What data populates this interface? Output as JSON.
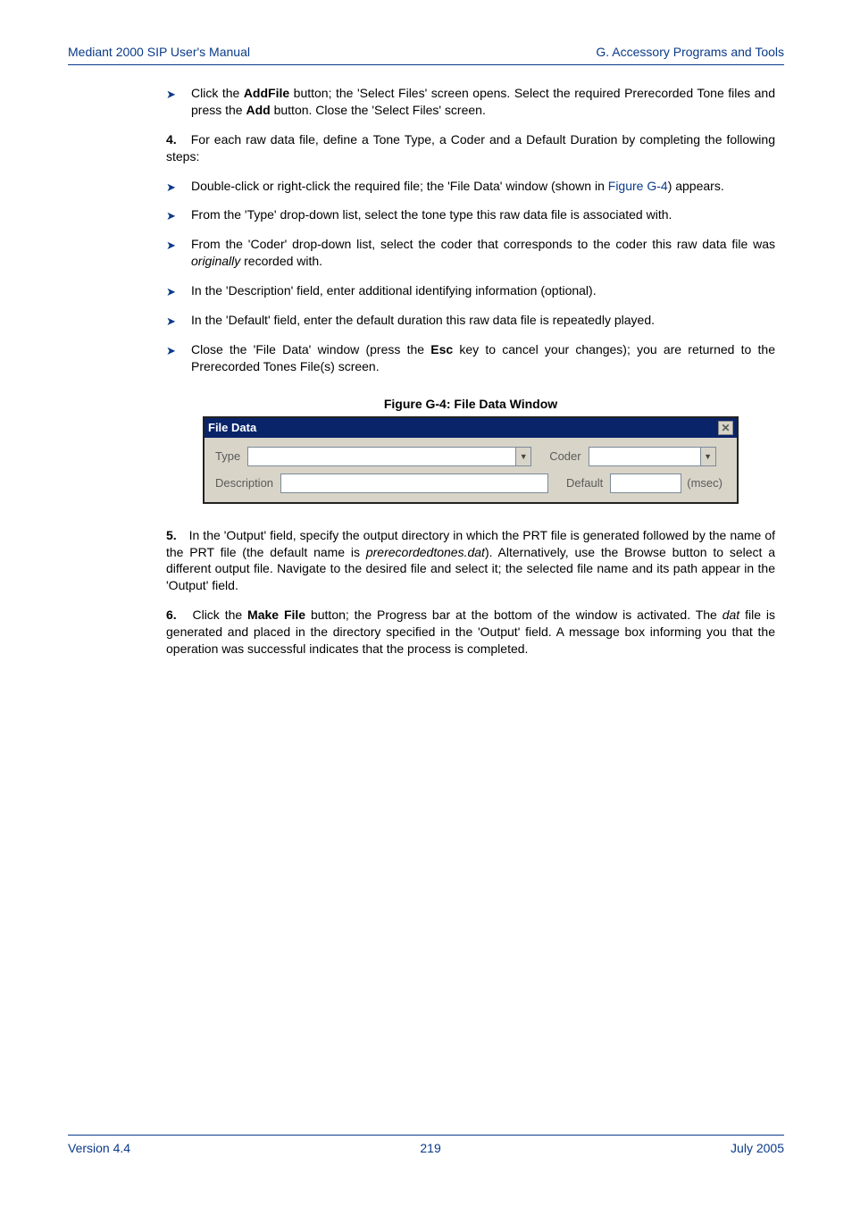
{
  "header": {
    "left": "Mediant 2000 SIP User's Manual",
    "right": "G. Accessory Programs and Tools"
  },
  "topBullet": {
    "pre": "Click the ",
    "btn1": "AddFile",
    "mid1": " button; the 'Select Files' screen opens. Select the required Prerecorded Tone files and press the ",
    "btn2": "Add",
    "post": " button. Close the 'Select Files' screen."
  },
  "step4": {
    "label": "4.",
    "text": "For each raw data file, define a Tone Type, a Coder and a Default Duration by completing the following steps:"
  },
  "subBullets": [
    {
      "pre": "Double-click or right-click the required file; the 'File Data' window (shown in ",
      "link": "Figure G-4",
      "post": ") appears."
    },
    {
      "text": "From the 'Type' drop-down list, select the tone type this raw data file is associated with."
    },
    {
      "pre": "From the 'Coder' drop-down list, select the coder that corresponds to the coder this raw data file was ",
      "emph": "originally",
      "post": " recorded with."
    },
    {
      "text": "In the 'Description' field, enter additional identifying information (optional)."
    },
    {
      "text": "In the 'Default' field, enter the default duration this raw data file is repeatedly played."
    },
    {
      "pre": "Close the 'File Data' window (press the ",
      "key": "Esc",
      "post": " key to cancel your changes); you are returned to the Prerecorded Tones File(s) screen."
    }
  ],
  "figure": {
    "caption": "Figure G-4: File Data Window",
    "title": "File Data",
    "labels": {
      "type": "Type",
      "coder": "Coder",
      "description": "Description",
      "default": "Default",
      "msec": "(msec)"
    }
  },
  "step5": {
    "label": "5.",
    "pre": "In the 'Output' field, specify the output directory in which the PRT file is generated followed by the name of the PRT file (the default name is ",
    "emph": "prerecordedtones.dat",
    "post": "). Alternatively, use the Browse button to select a different output file. Navigate to the desired file and select it; the selected file name and its path appear in the 'Output' field."
  },
  "step6": {
    "label": "6.",
    "pre": "Click the ",
    "btn": "Make File",
    "mid": " button; the Progress bar at the bottom of the window is activated. The ",
    "emph": "dat",
    "post": " file is generated and placed in the directory specified in the 'Output' field. A message box informing you that the operation was successful indicates that the process is completed."
  },
  "footer": {
    "left": "Version 4.4",
    "center": "219",
    "right": "July 2005"
  }
}
